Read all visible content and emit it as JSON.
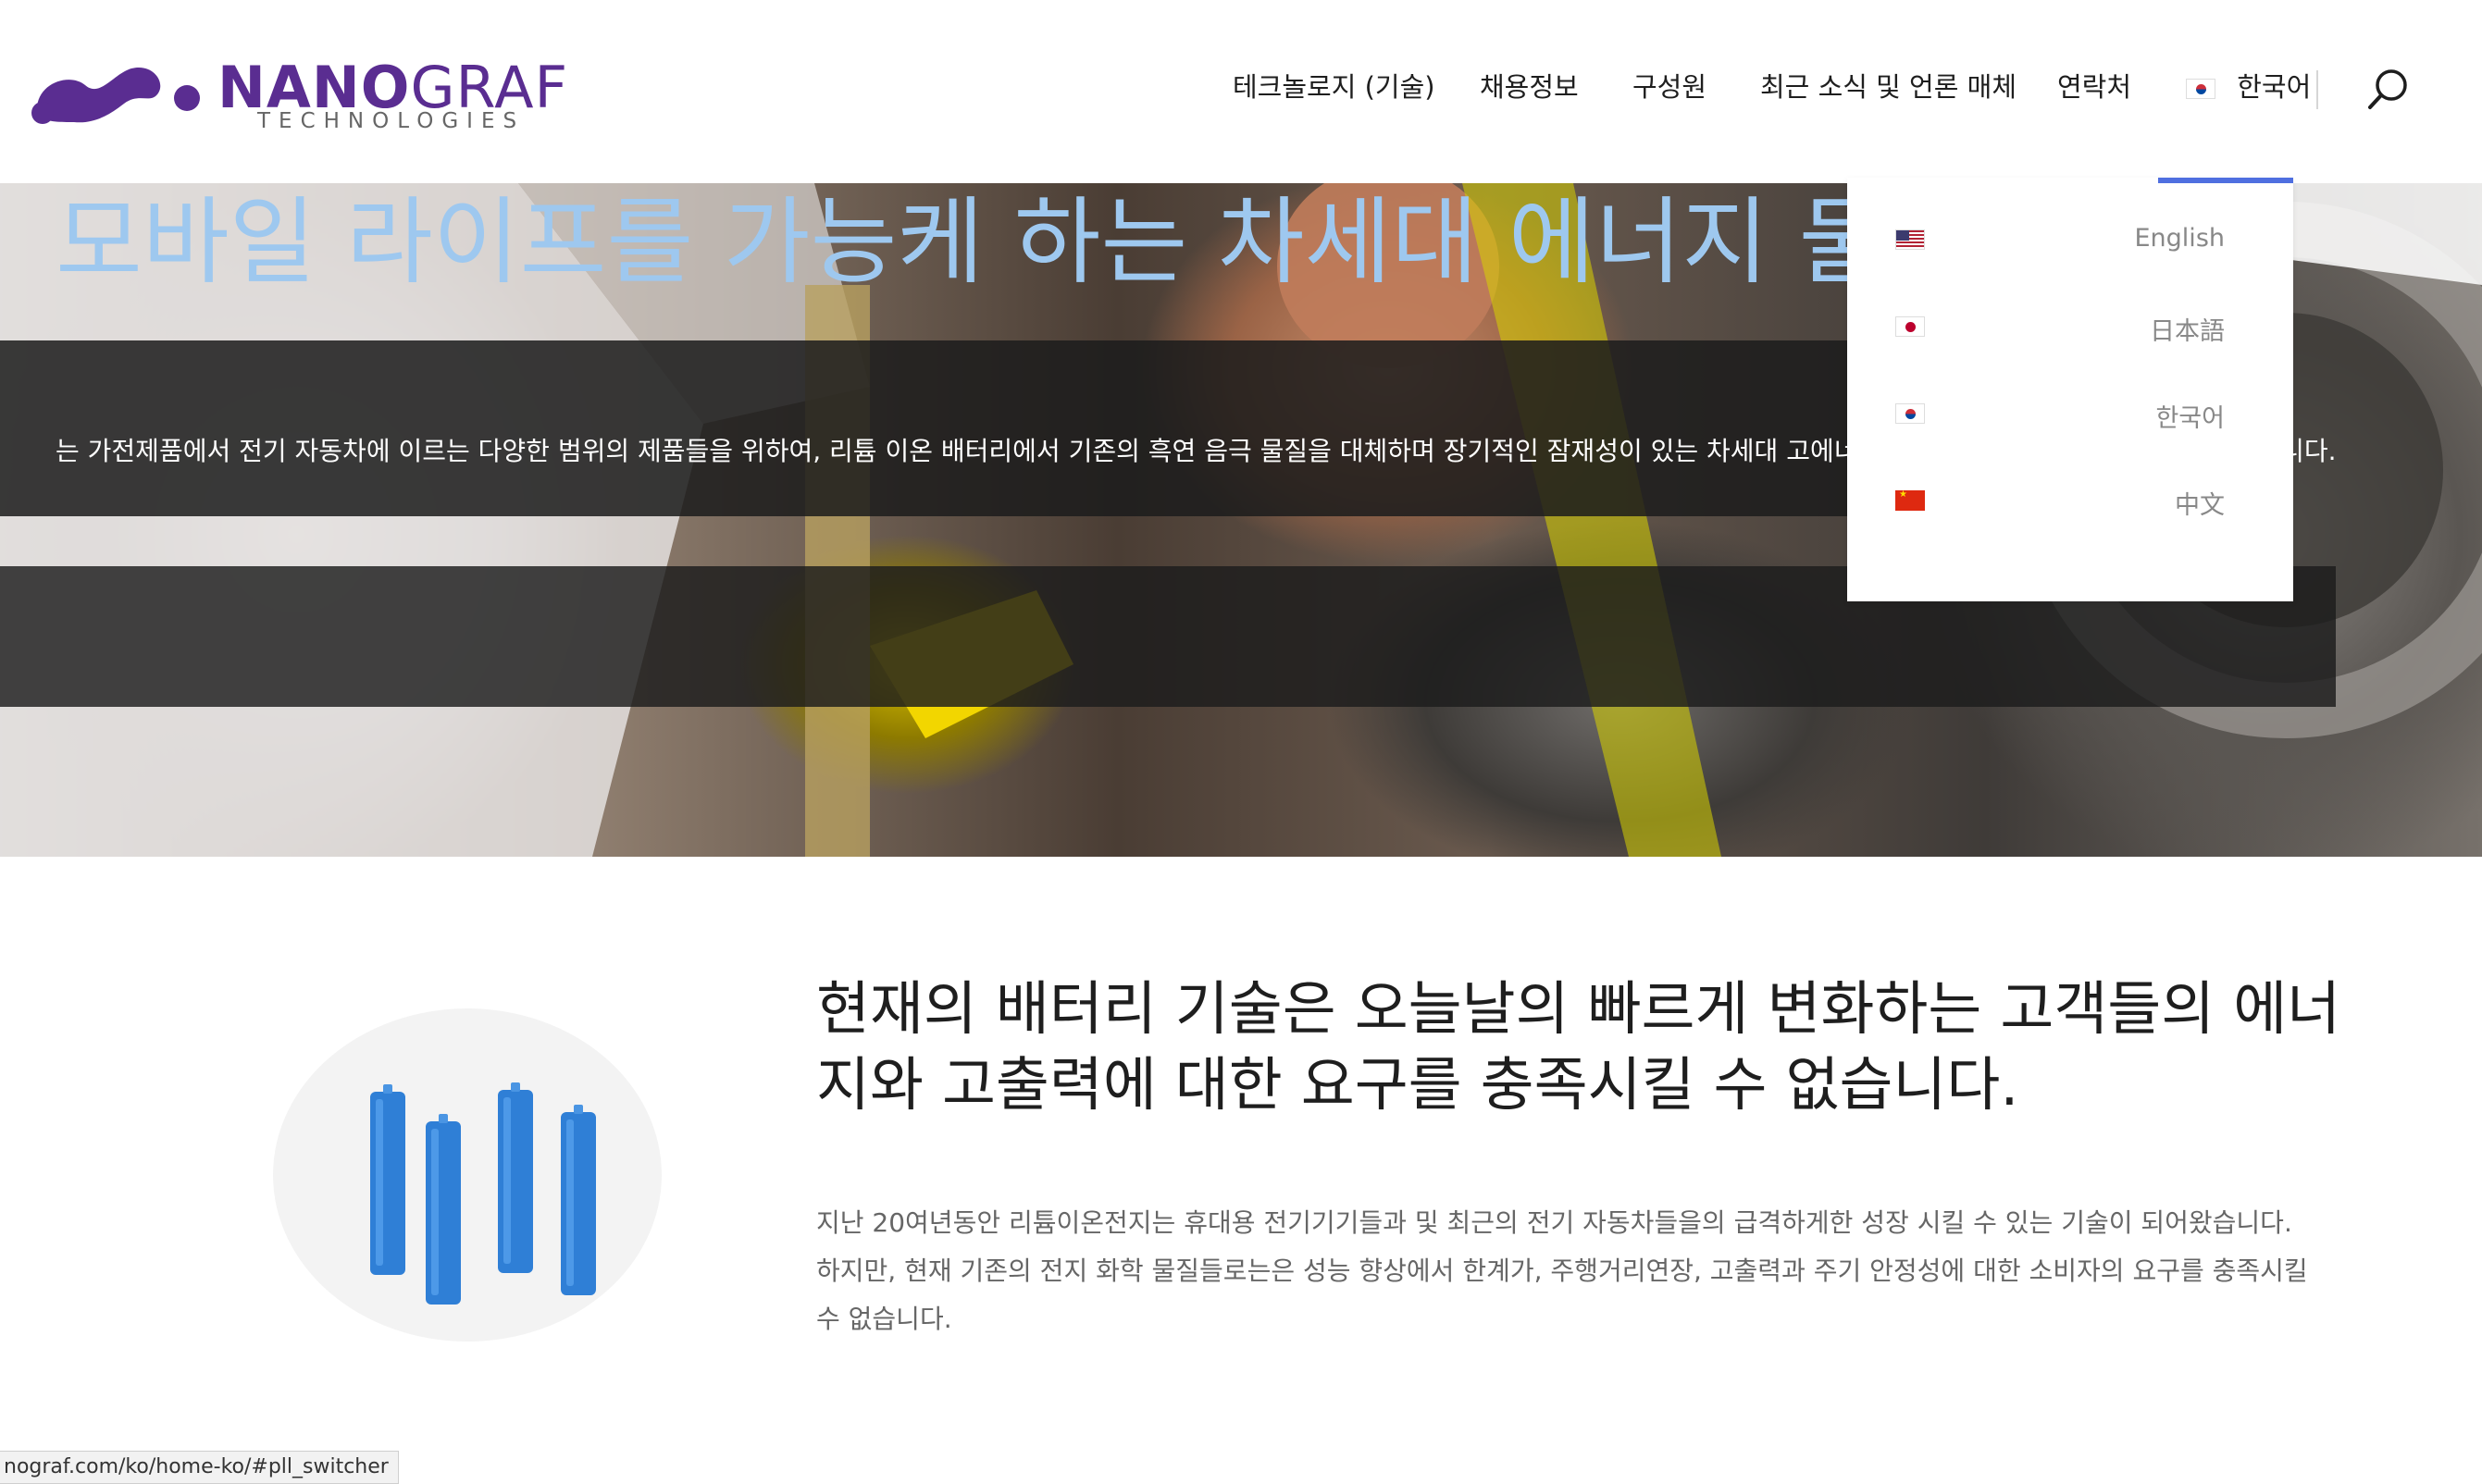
{
  "header": {
    "logo": {
      "wordmark_bold": "NANO",
      "wordmark_light": "GRAF",
      "subtitle": "TECHNOLOGIES",
      "brand_color": "#5a2d91"
    },
    "nav": [
      {
        "label": "테크놀로지 (기술)"
      },
      {
        "label": "채용정보"
      },
      {
        "label": "구성원"
      },
      {
        "label": "최근 소식 및 언론 매체"
      },
      {
        "label": "연락처"
      }
    ],
    "language_switcher": {
      "label": "한국어",
      "flag": "kr-flag-icon"
    },
    "search_icon": "search-icon"
  },
  "language_dropdown": {
    "accent_color": "#4f6fe0",
    "items": [
      {
        "label": "English",
        "flag": "us-flag-icon"
      },
      {
        "label": "日本語",
        "flag": "jp-flag-icon"
      },
      {
        "label": "한국어",
        "flag": "kr-flag-icon"
      },
      {
        "label": "中文",
        "flag": "cn-flag-icon"
      }
    ]
  },
  "hero": {
    "title": "모바일 라이프를 가능케 하는 차세대 에너지 물",
    "subtitle": "는 가전제품에서 전기 자동차에 이르는 다양한 범위의 제품들을 위하여, 리튬 이온 배터리에서 기존의 흑연 음극 물질을 대체하며 장기적인 잠재성이 있는 차세대 고에너지 실리콘 기반의 음극 물질을 보여왔습니다.",
    "title_color": "#9ec8ef"
  },
  "section": {
    "heading": "현재의 배터리 기술은 오늘날의 빠르게 변화하는 고객들의 에너지와 고출력에 대한 요구를 충족시킬 수 없습니다.",
    "body": "지난 20여년동안 리튬이온전지는 휴대용 전기기기들과 및 최근의 전기 자동차들을의 급격하게한 성장 시킬 수 있는 기술이 되어왔습니다. 하지만, 현재 기존의 전지 화학 물질들로는은 성능 향상에서 한계가, 주행거리연장, 고출력과 주기 안정성에 대한 소비자의 요구를 충족시킬 수 없습니다.",
    "image": "battery-cells-image"
  },
  "status_bar": {
    "url": "nograf.com/ko/home-ko/#pll_switcher"
  }
}
